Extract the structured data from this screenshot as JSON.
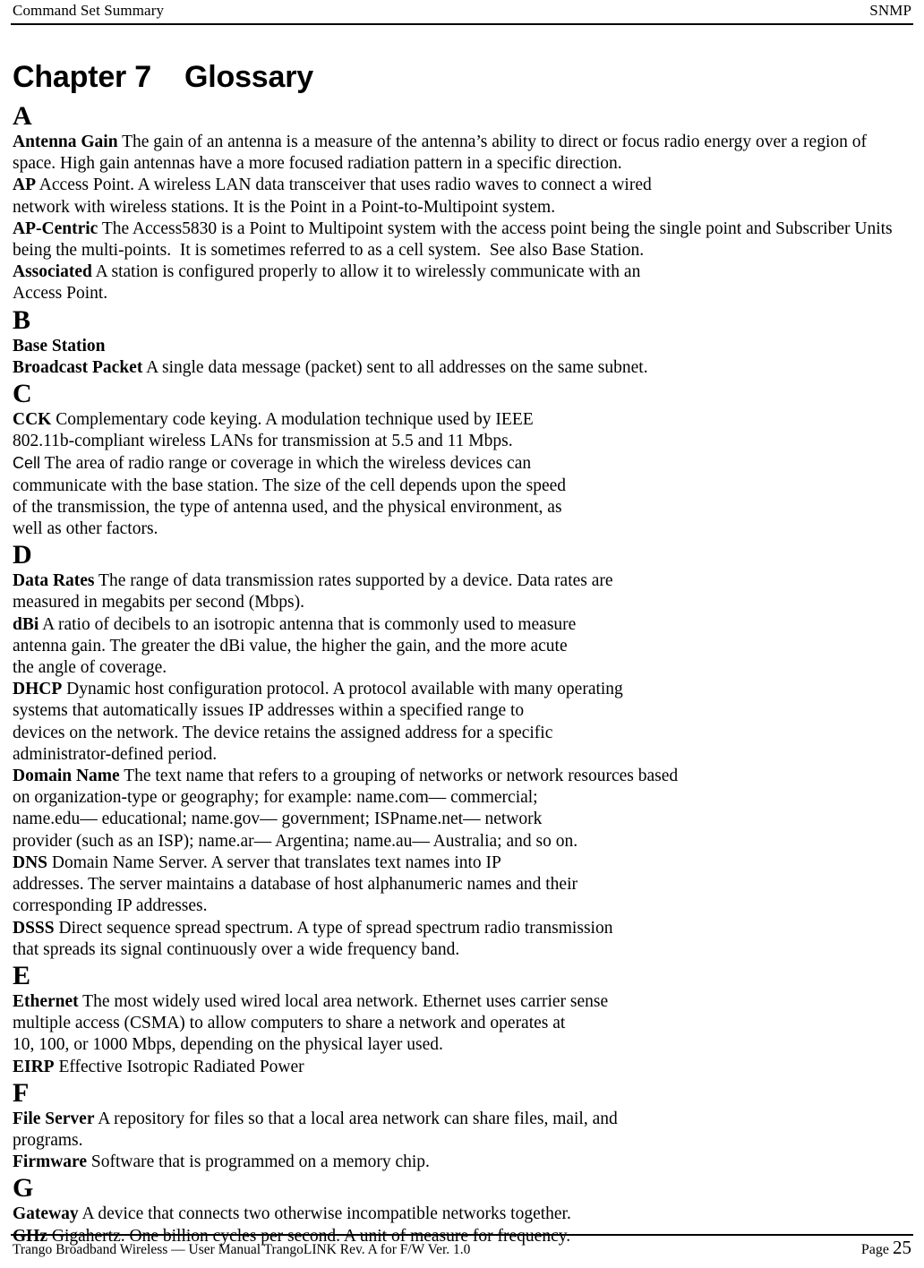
{
  "header": {
    "left_text": "Command Set Summary",
    "right_text": "SNMP"
  },
  "chapter": {
    "title": "Chapter 7    Glossary"
  },
  "glossary": {
    "sections": [
      {
        "letter": "A",
        "entries": [
          {
            "term": "Antenna Gain",
            "definition": " The gain of an antenna is a measure of the antenna’s ability to direct or focus radio energy over a region of\nspace. High gain antennas have a more focused radiation pattern in a specific direction."
          },
          {
            "term": "AP",
            "definition": " Access Point. A wireless LAN data transceiver that uses radio waves to connect a wired\nnetwork with wireless stations. It is the Point in a Point-to-Multipoint system."
          },
          {
            "term": "AP-Centric",
            "definition": " The Access5830 is a Point to Multipoint system with the access point being the single point and Subscriber Units\nbeing the multi-points.  It is sometimes referred to as a cell system.  See also Base Station."
          },
          {
            "term": "Associated",
            "definition": " A station is configured properly to allow it to wirelessly communicate with an\nAccess Point."
          }
        ]
      },
      {
        "letter": "B",
        "entries": [
          {
            "term": "Base Station",
            "definition": ""
          },
          {
            "term": "Broadcast Packet",
            "definition": " A single data message (packet) sent to all addresses on the same subnet."
          }
        ]
      },
      {
        "letter": "C",
        "entries": [
          {
            "term": "CCK",
            "definition": " Complementary code keying. A modulation technique used by IEEE\n802.11b-compliant wireless LANs for transmission at 5.5 and 11 Mbps."
          },
          {
            "term": "Cell",
            "term_style": "sans",
            "definition": " The area of radio range or coverage in which the wireless devices can\ncommunicate with the base station. The size of the cell depends upon the speed\nof the transmission, the type of antenna used, and the physical environment, as\nwell as other factors."
          }
        ]
      },
      {
        "letter": "D",
        "entries": [
          {
            "term": "Data Rates",
            "definition": " The range of data transmission rates supported by a device. Data rates are\nmeasured in megabits per second (Mbps)."
          },
          {
            "term": "dBi",
            "definition": " A ratio of decibels to an isotropic antenna that is commonly used to measure\nantenna gain. The greater the dBi value, the higher the gain, and the more acute\nthe angle of coverage."
          },
          {
            "term": "DHCP",
            "definition": " Dynamic host configuration protocol. A protocol available with many operating\nsystems that automatically issues IP addresses within a specified range to\ndevices on the network. The device retains the assigned address for a specific\nadministrator-defined period."
          },
          {
            "term": "Domain Name",
            "definition": " The text name that refers to a grouping of networks or network resources based\non organization-type or geography; for example: name.com— commercial;\nname.edu— educational; name.gov— government; ISPname.net— network\nprovider (such as an ISP); name.ar— Argentina; name.au— Australia; and so on."
          },
          {
            "term": "DNS",
            "definition": " Domain Name Server. A server that translates text names into IP\naddresses. The server maintains a database of host alphanumeric names and their\ncorresponding IP addresses."
          },
          {
            "term": "DSSS",
            "definition": " Direct sequence spread spectrum. A type of spread spectrum radio transmission\nthat spreads its signal continuously over a wide frequency band."
          }
        ]
      },
      {
        "letter": "E",
        "entries": [
          {
            "term": "Ethernet",
            "definition": " The most widely used wired local area network. Ethernet uses carrier sense\nmultiple access (CSMA) to allow computers to share a network and operates at\n10, 100, or 1000 Mbps, depending on the physical layer used."
          },
          {
            "term": "EIRP",
            "definition": " Effective Isotropic Radiated Power"
          }
        ]
      },
      {
        "letter": "F",
        "entries": [
          {
            "term": "File Server",
            "definition": " A repository for files so that a local area network can share files, mail, and\nprograms."
          },
          {
            "term": "Firmware",
            "definition": " Software that is programmed on a memory chip."
          }
        ]
      },
      {
        "letter": "G",
        "entries": [
          {
            "term": "Gateway",
            "definition": " A device that connects two otherwise incompatible networks together."
          },
          {
            "term": "GHz",
            "definition": " Gigahertz. One billion cycles per second. A unit of measure for frequency."
          }
        ]
      }
    ]
  },
  "footer": {
    "left_text": "Trango Broadband Wireless — User Manual TrangoLINK  Rev. A  for F/W Ver. 1.0",
    "page_label": "Page ",
    "page_number": "25"
  }
}
